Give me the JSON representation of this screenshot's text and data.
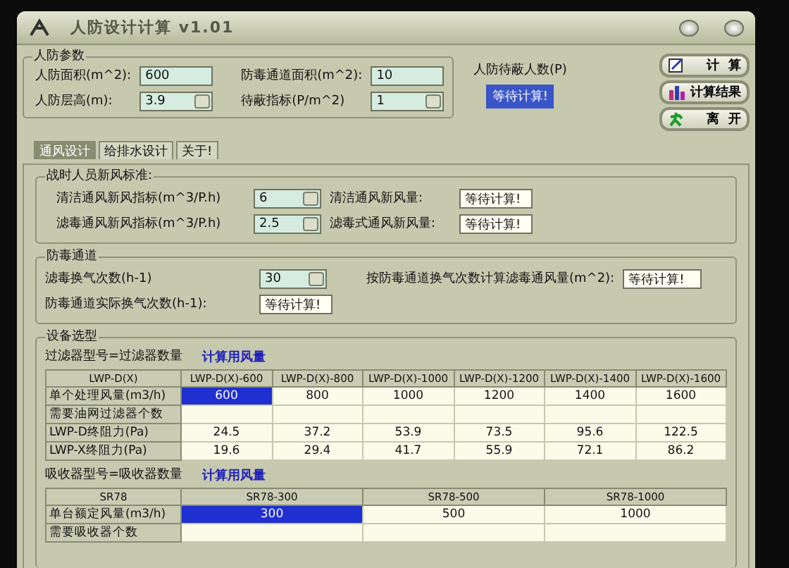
{
  "window": {
    "title": "人防设计计算 v1.01"
  },
  "params": {
    "title": "人防参数",
    "fields": [
      {
        "label": "人防面积(m^2):",
        "value": "600",
        "kind": "text"
      },
      {
        "label": "防毒通道面积(m^2):",
        "value": "10",
        "kind": "text"
      },
      {
        "label": "人防层高(m):",
        "value": "3.9",
        "kind": "spin"
      },
      {
        "label": "待蔽指标(P/m^2)",
        "value": "1",
        "kind": "spin"
      }
    ]
  },
  "shelter": {
    "label": "人防待蔽人数(P)",
    "value": "等待计算!",
    "selected": true
  },
  "buttons": [
    {
      "label": "计  算"
    },
    {
      "label": "计算结果"
    },
    {
      "label": "离  开"
    }
  ],
  "tabs": [
    {
      "label": "通风设计",
      "selected": true
    },
    {
      "label": "给排水设计",
      "selected": false
    },
    {
      "label": "关于!",
      "selected": false
    }
  ],
  "fresh_air": {
    "title": "战时人员新风标准:",
    "rows": [
      {
        "label": "清洁通风新风指标(m^3/P.h)",
        "value": "6",
        "result_label": "清洁通风新风量:",
        "result": "等待计算!"
      },
      {
        "label": "滤毒通风新风指标(m^3/P.h)",
        "value": "2.5",
        "result_label": "滤毒式通风新风量:",
        "result": "等待计算!"
      }
    ]
  },
  "airlock": {
    "title": "防毒通道",
    "rate_label": "滤毒换气次数(h-1)",
    "rate": "30",
    "volume_label": "按防毒通道换气次数计算滤毒通风量(m^2):",
    "volume": "等待计算!",
    "actual_label": "防毒通道实际换气次数(h-1):",
    "actual": "等待计算!"
  },
  "equipment": {
    "title": "设备选型",
    "filters": {
      "caption": "过滤器型号=过滤器数量",
      "link": "计算用风量",
      "corner": "LWP-D(X)",
      "columns": [
        "LWP-D(X)-600",
        "LWP-D(X)-800",
        "LWP-D(X)-1000",
        "LWP-D(X)-1200",
        "LWP-D(X)-1400",
        "LWP-D(X)-1600"
      ],
      "rows": [
        {
          "label": "单个处理风量(m3/h)",
          "cells": [
            {
              "text": "600",
              "selected": true
            },
            {
              "text": "800",
              "selected": false
            },
            {
              "text": "1000",
              "selected": false
            },
            {
              "text": "1200",
              "selected": false
            },
            {
              "text": "1400",
              "selected": false
            },
            {
              "text": "1600",
              "selected": false
            }
          ]
        },
        {
          "label": "需要油网过滤器个数",
          "cells": [
            {
              "text": "",
              "selected": false
            },
            {
              "text": "",
              "selected": false
            },
            {
              "text": "",
              "selected": false
            },
            {
              "text": "",
              "selected": false
            },
            {
              "text": "",
              "selected": false
            },
            {
              "text": "",
              "selected": false
            }
          ]
        },
        {
          "label": "LWP-D终阻力(Pa)",
          "cells": [
            {
              "text": "24.5",
              "selected": false
            },
            {
              "text": "37.2",
              "selected": false
            },
            {
              "text": "53.9",
              "selected": false
            },
            {
              "text": "73.5",
              "selected": false
            },
            {
              "text": "95.6",
              "selected": false
            },
            {
              "text": "122.5",
              "selected": false
            }
          ]
        },
        {
          "label": "LWP-X终阻力(Pa)",
          "cells": [
            {
              "text": "19.6",
              "selected": false
            },
            {
              "text": "29.4",
              "selected": false
            },
            {
              "text": "41.7",
              "selected": false
            },
            {
              "text": "55.9",
              "selected": false
            },
            {
              "text": "72.1",
              "selected": false
            },
            {
              "text": "86.2",
              "selected": false
            }
          ]
        }
      ]
    },
    "absorbers": {
      "caption": "吸收器型号=吸收器数量",
      "link": "计算用风量",
      "corner": "SR78",
      "columns": [
        "SR78-300",
        "SR78-500",
        "SR78-1000"
      ],
      "rows": [
        {
          "label": "单台额定风量(m3/h)",
          "cells": [
            {
              "text": "300",
              "selected": true
            },
            {
              "text": "500",
              "selected": false
            },
            {
              "text": "1000",
              "selected": false
            }
          ]
        },
        {
          "label": "需要吸收器个数",
          "cells": [
            {
              "text": "",
              "selected": false
            },
            {
              "text": "",
              "selected": false
            },
            {
              "text": "",
              "selected": false
            }
          ]
        }
      ]
    }
  }
}
